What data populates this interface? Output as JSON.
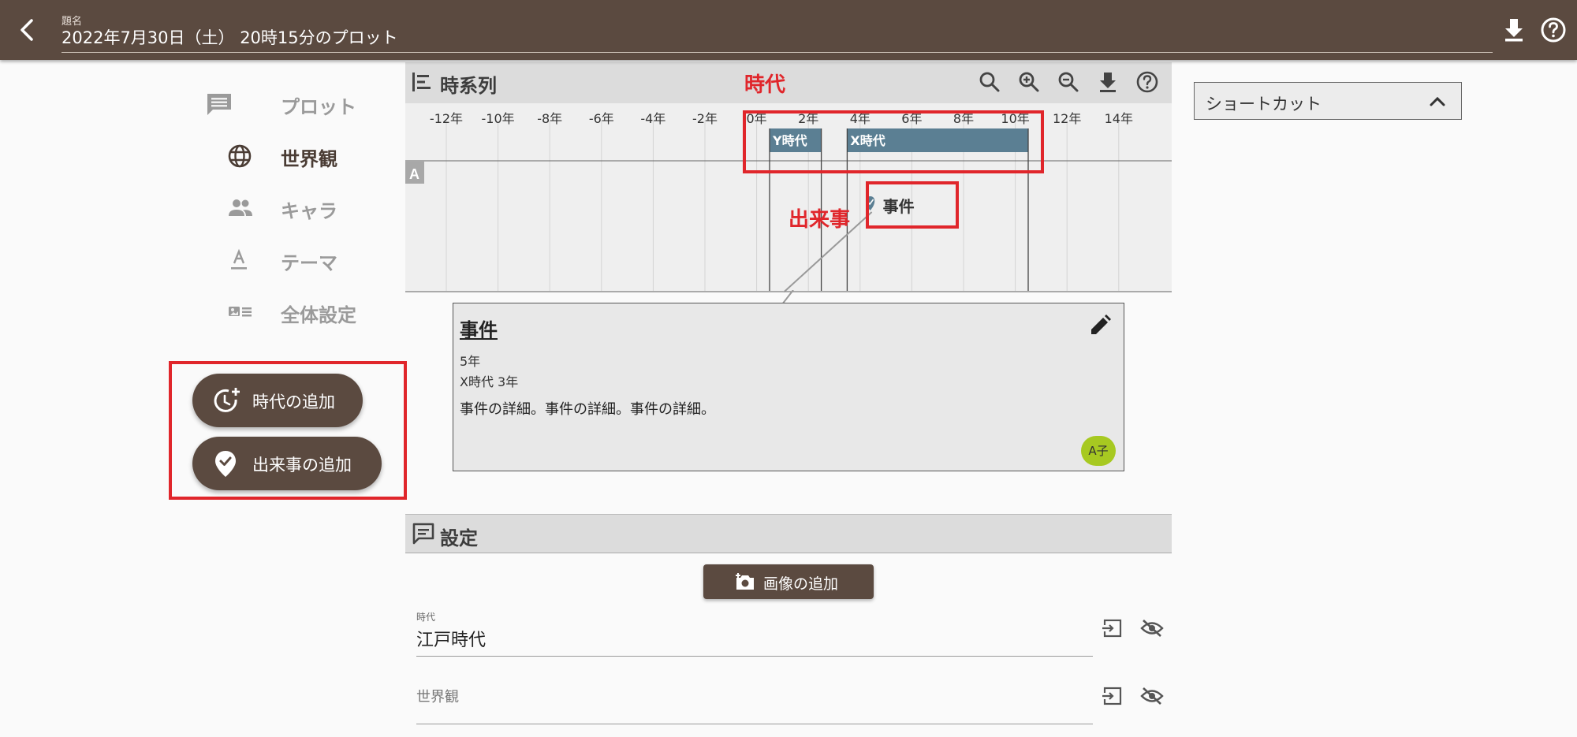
{
  "header": {
    "title_label": "題名",
    "title": "2022年7月30日（土） 20時15分のプロット"
  },
  "nav": {
    "items": [
      {
        "label": "プロット",
        "icon": "comment-icon",
        "active": false
      },
      {
        "label": "世界観",
        "icon": "globe-icon",
        "active": true
      },
      {
        "label": "キャラ",
        "icon": "people-icon",
        "active": false
      },
      {
        "label": "テーマ",
        "icon": "text-format-icon",
        "active": false
      },
      {
        "label": "全体設定",
        "icon": "settings-card-icon",
        "active": false
      }
    ],
    "add_era": "時代の追加",
    "add_event": "出来事の追加"
  },
  "timeline": {
    "title": "時系列",
    "annotation_era": "時代",
    "annotation_event": "出来事",
    "ticks": [
      "-12年",
      "-10年",
      "-8年",
      "-6年",
      "-4年",
      "-2年",
      "0年",
      "2年",
      "4年",
      "6年",
      "8年",
      "10年",
      "12年",
      "14年"
    ],
    "eras": [
      {
        "label": "Y時代",
        "start": 0.5,
        "end": 2.5
      },
      {
        "label": "X時代",
        "start": 3.5,
        "end": 10.5
      }
    ],
    "lane_label": "A",
    "event": {
      "label": "事件",
      "year": 5
    },
    "colors": {
      "era": "#5b7f93",
      "annotation": "#e0262b"
    }
  },
  "event_card": {
    "title": "事件",
    "year": "5年",
    "era_line": "X時代 3年",
    "detail": "事件の詳細。事件の詳細。事件の詳細。",
    "character": "A子"
  },
  "settings": {
    "title": "設定",
    "add_image": "画像の追加",
    "fields": [
      {
        "label": "時代",
        "value": "江戸時代"
      },
      {
        "label": "世界観",
        "value": ""
      }
    ]
  },
  "shortcut": {
    "label": "ショートカット"
  },
  "colors": {
    "brand": "#5b4a40",
    "highlight": "#e0262b",
    "character_badge": "#a7c921"
  }
}
